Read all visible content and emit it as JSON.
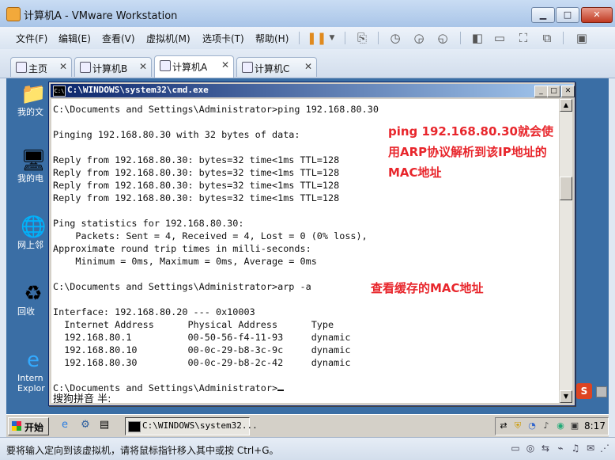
{
  "window": {
    "title": "计算机A - VMware Workstation"
  },
  "menu": [
    "文件(F)",
    "编辑(E)",
    "查看(V)",
    "虚拟机(M)",
    "选项卡(T)",
    "帮助(H)"
  ],
  "tabs": [
    {
      "label": "主页",
      "close": "✕"
    },
    {
      "label": "计算机B",
      "close": "✕"
    },
    {
      "label": "计算机A",
      "close": "✕",
      "active": true
    },
    {
      "label": "计算机C",
      "close": "✕"
    }
  ],
  "desktop_icons": [
    "我的文",
    "我的电",
    "网上邻",
    "回收",
    "Intern\nExplor"
  ],
  "cmd": {
    "title": "C:\\WINDOWS\\system32\\cmd.exe",
    "lines": [
      "C:\\Documents and Settings\\Administrator>ping 192.168.80.30",
      "",
      "Pinging 192.168.80.30 with 32 bytes of data:",
      "",
      "Reply from 192.168.80.30: bytes=32 time<1ms TTL=128",
      "Reply from 192.168.80.30: bytes=32 time<1ms TTL=128",
      "Reply from 192.168.80.30: bytes=32 time<1ms TTL=128",
      "Reply from 192.168.80.30: bytes=32 time<1ms TTL=128",
      "",
      "Ping statistics for 192.168.80.30:",
      "    Packets: Sent = 4, Received = 4, Lost = 0 (0% loss),",
      "Approximate round trip times in milli-seconds:",
      "    Minimum = 0ms, Maximum = 0ms, Average = 0ms",
      "",
      "C:\\Documents and Settings\\Administrator>arp -a",
      "",
      "Interface: 192.168.80.20 --- 0x10003",
      "  Internet Address      Physical Address      Type",
      "  192.168.80.1          00-50-56-f4-11-93     dynamic",
      "  192.168.80.10         00-0c-29-b8-3c-9c     dynamic",
      "  192.168.80.30         00-0c-29-b8-2c-42     dynamic",
      "",
      "C:\\Documents and Settings\\Administrator>"
    ],
    "ime_text": "搜狗拼音 半:",
    "annotation_ping": "ping 192.168.80.30就会使用ARP协议解析到该IP地址的MAC地址",
    "annotation_arp": "查看缓存的MAC地址"
  },
  "taskbar": {
    "start_label": "开始",
    "task_label": "C:\\WINDOWS\\system32...",
    "clock": "8:17"
  },
  "status_text": "要将输入定向到该虚拟机，请将鼠标指针移入其中或按 Ctrl+G。",
  "colors": {
    "annotation": "#e8262c",
    "desktop": "#3a6ea5",
    "cmd_title_start": "#0a246a"
  }
}
